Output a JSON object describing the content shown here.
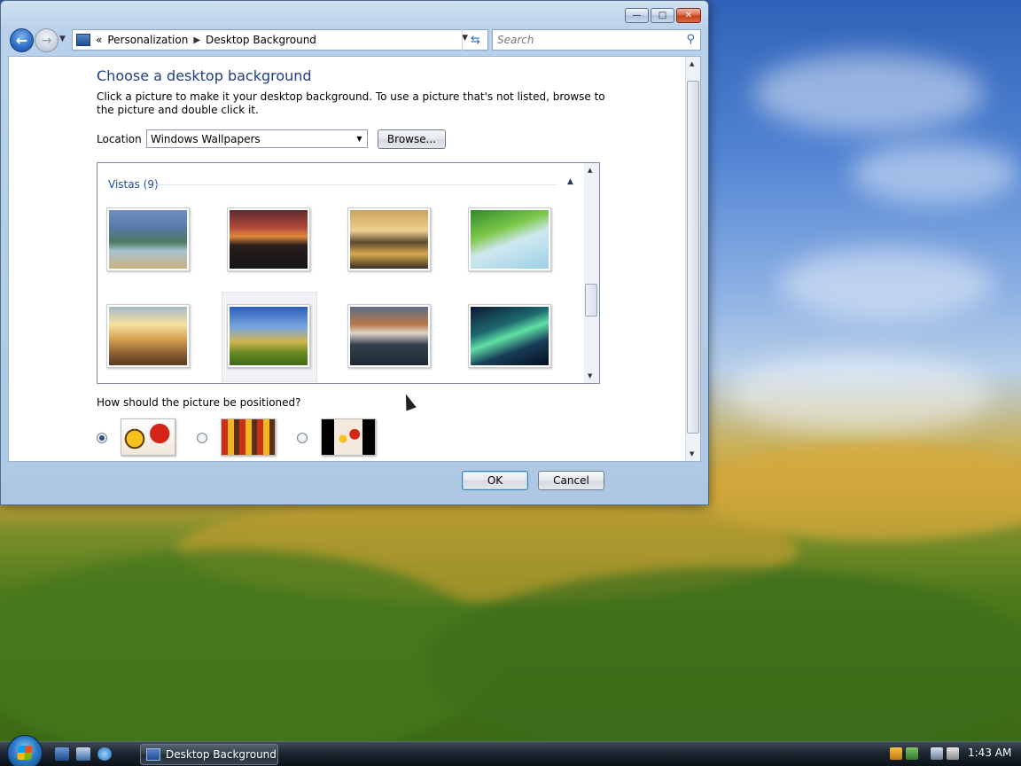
{
  "window": {
    "caption_buttons": [
      "minimize",
      "maximize",
      "close"
    ]
  },
  "nav": {
    "breadcrumb": [
      "Personalization",
      "Desktop Background"
    ],
    "overflow_glyph": "«",
    "search_placeholder": "Search"
  },
  "content": {
    "heading": "Choose a desktop background",
    "description": "Click a picture to make it your desktop background. To use a picture that's not listed, browse to the picture and double click it.",
    "location_label": "Location",
    "location_value": "Windows Wallpapers",
    "browse_label": "Browse...",
    "group_title": "Vistas (9)",
    "thumbnails": [
      {
        "name": "mountain-lake",
        "selected": false
      },
      {
        "name": "sunset-silhouette",
        "selected": false
      },
      {
        "name": "golden-rocks",
        "selected": false
      },
      {
        "name": "palm-frond",
        "selected": false
      },
      {
        "name": "sun-grass",
        "selected": false
      },
      {
        "name": "sky-meadow",
        "selected": true
      },
      {
        "name": "rock-reflection",
        "selected": false
      },
      {
        "name": "aurora",
        "selected": false
      }
    ],
    "position_question": "How should the picture be positioned?",
    "position_options": [
      {
        "name": "fit-to-screen",
        "checked": true
      },
      {
        "name": "tile",
        "checked": false
      },
      {
        "name": "center",
        "checked": false
      }
    ]
  },
  "buttons": {
    "ok": "OK",
    "cancel": "Cancel"
  },
  "taskbar": {
    "window_button": "Desktop Background",
    "clock": "1:43 AM"
  }
}
